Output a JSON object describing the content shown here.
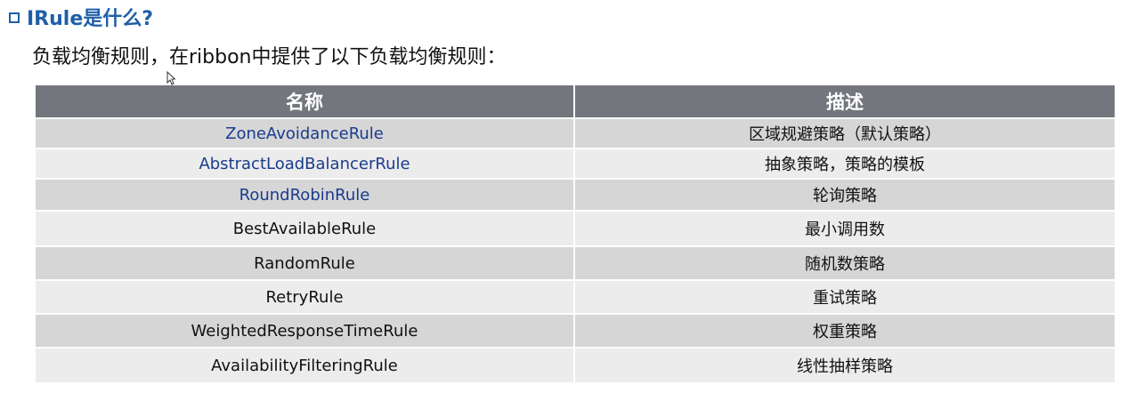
{
  "heading": {
    "title": "IRule是什么?"
  },
  "intro": {
    "text": "负载均衡规则，在ribbon中提供了以下负载均衡规则："
  },
  "table": {
    "headers": [
      "名称",
      "描述"
    ],
    "rows": [
      {
        "name": "ZoneAvoidanceRule",
        "desc": "区域规避策略（默认策略）",
        "highlight": true
      },
      {
        "name": "AbstractLoadBalancerRule",
        "desc": "抽象策略，策略的模板",
        "highlight": true
      },
      {
        "name": "RoundRobinRule",
        "desc": "轮询策略",
        "highlight": true
      },
      {
        "name": "BestAvailableRule",
        "desc": "最小调用数",
        "highlight": false
      },
      {
        "name": "RandomRule",
        "desc": "随机数策略",
        "highlight": false
      },
      {
        "name": "RetryRule",
        "desc": "重试策略",
        "highlight": false
      },
      {
        "name": "WeightedResponseTimeRule",
        "desc": "权重策略",
        "highlight": false
      },
      {
        "name": "AvailabilityFilteringRule",
        "desc": "线性抽样策略",
        "highlight": false
      }
    ]
  },
  "colors": {
    "heading": "#1f5fa8",
    "header_bg": "#73767d",
    "row_dark": "#d6d6d6",
    "row_light": "#ececec",
    "highlight_text": "#1a3c8c"
  }
}
